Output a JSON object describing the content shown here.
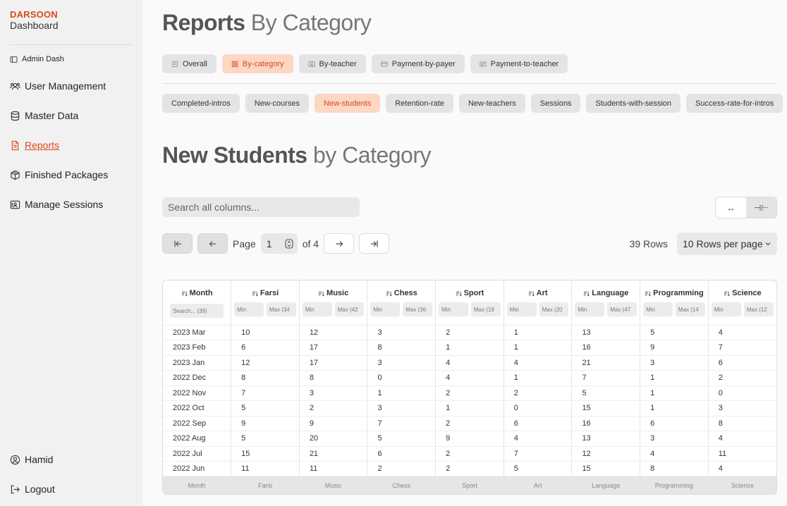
{
  "brand": {
    "name": "DARSOON",
    "sub": "Dashboard"
  },
  "sidebar": {
    "admin": "Admin Dash",
    "items": [
      {
        "label": "User Management",
        "icon": "users-icon"
      },
      {
        "label": "Master Data",
        "icon": "database-icon"
      },
      {
        "label": "Reports",
        "icon": "file-icon"
      },
      {
        "label": "Finished Packages",
        "icon": "package-icon"
      },
      {
        "label": "Manage Sessions",
        "icon": "sessions-icon"
      }
    ],
    "user": "Hamid",
    "logout": "Logout"
  },
  "header": {
    "title_bold": "Reports",
    "title_light": "By Category"
  },
  "tabs": [
    "Overall",
    "By-category",
    "By-teacher",
    "Payment-by-payer",
    "Payment-to-teacher"
  ],
  "subtabs": [
    "Completed-intros",
    "New-courses",
    "New-students",
    "Retention-rate",
    "New-teachers",
    "Sessions",
    "Students-with-session",
    "Success-rate-for-intros"
  ],
  "section": {
    "title_bold": "New Students",
    "title_light": "by Category"
  },
  "search": {
    "placeholder": "Search all columns..."
  },
  "density": {
    "expand_icon": "↔",
    "compact_icon": "⊣⊢"
  },
  "pager": {
    "page_label": "Page",
    "page": "1",
    "of_label": "of 4"
  },
  "rows": {
    "count": "39 Rows",
    "per_page": "10 Rows per page"
  },
  "table": {
    "columns": [
      "Month",
      "Farsi",
      "Music",
      "Chess",
      "Sport",
      "Art",
      "Language",
      "Programming",
      "Science"
    ],
    "month_filter": "Search... (39)",
    "min_label": "Min",
    "max_labels": [
      "Max (34",
      "Max (42",
      "Max (36",
      "Max (19",
      "Max (20",
      "Max (47",
      "Max (14",
      "Max (12"
    ],
    "rows": [
      [
        "2023 Mar",
        "10",
        "12",
        "3",
        "2",
        "1",
        "13",
        "5",
        "4"
      ],
      [
        "2023 Feb",
        "6",
        "17",
        "8",
        "1",
        "1",
        "16",
        "9",
        "7"
      ],
      [
        "2023 Jan",
        "12",
        "17",
        "3",
        "4",
        "4",
        "21",
        "3",
        "6"
      ],
      [
        "2022 Dec",
        "8",
        "8",
        "0",
        "4",
        "1",
        "7",
        "1",
        "2"
      ],
      [
        "2022 Nov",
        "7",
        "3",
        "1",
        "2",
        "2",
        "5",
        "1",
        "0"
      ],
      [
        "2022 Oct",
        "5",
        "2",
        "3",
        "1",
        "0",
        "15",
        "1",
        "3"
      ],
      [
        "2022 Sep",
        "9",
        "9",
        "7",
        "2",
        "6",
        "16",
        "6",
        "8"
      ],
      [
        "2022 Aug",
        "5",
        "20",
        "5",
        "9",
        "4",
        "13",
        "3",
        "4"
      ],
      [
        "2022 Jul",
        "15",
        "21",
        "6",
        "2",
        "7",
        "12",
        "4",
        "11"
      ],
      [
        "2022 Jun",
        "11",
        "11",
        "2",
        "2",
        "5",
        "15",
        "8",
        "4"
      ]
    ]
  },
  "colors": {
    "accent": "#d94a16",
    "accent_bg": "#fcd7c3"
  }
}
